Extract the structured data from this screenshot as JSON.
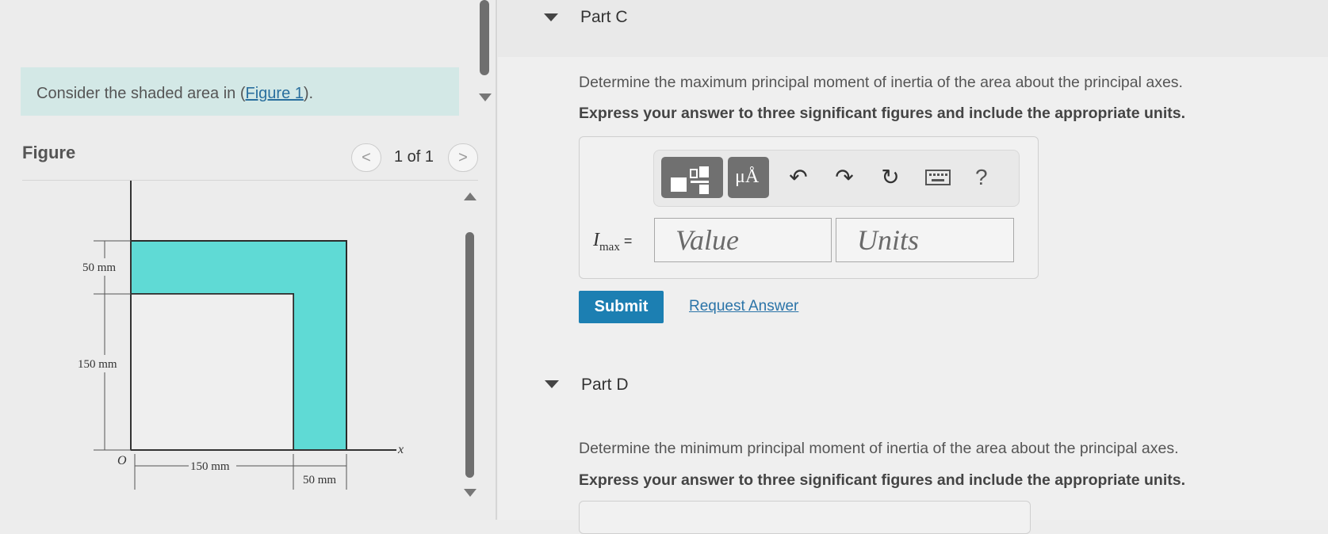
{
  "left": {
    "intro": {
      "prefix": "Consider the shaded area in (",
      "link": "Figure 1",
      "suffix": ")."
    },
    "figure": {
      "title": "Figure",
      "pager": {
        "prev": "<",
        "count": "1 of 1",
        "next": ">"
      },
      "labels": {
        "dim_50_top": "50 mm",
        "dim_150_left": "150 mm",
        "dim_150_bottom": "150 mm",
        "dim_50_bottom": "50 mm",
        "origin": "O",
        "x_axis": "x"
      },
      "fill_color": "#5fdad5"
    }
  },
  "part_c": {
    "title": "Part C",
    "question": "Determine the maximum principal moment of inertia of the area about the principal axes.",
    "instruction": "Express your answer to three significant figures and include the appropriate units.",
    "answer": {
      "label_main": "I",
      "label_sub": "max",
      "label_eq": " =",
      "value_placeholder": "Value",
      "units_placeholder": "Units"
    },
    "toolbar": {
      "units_glyph": "μÅ",
      "help": "?"
    },
    "submit": "Submit",
    "request_answer": "Request Answer"
  },
  "part_d": {
    "title": "Part D",
    "question": "Determine the minimum principal moment of inertia of the area about the principal axes.",
    "instruction": "Express your answer to three significant figures and include the appropriate units."
  },
  "colors": {
    "accent": "#1c7fb2",
    "link": "#2b74a8",
    "intro_bg": "#d3e8e6"
  }
}
